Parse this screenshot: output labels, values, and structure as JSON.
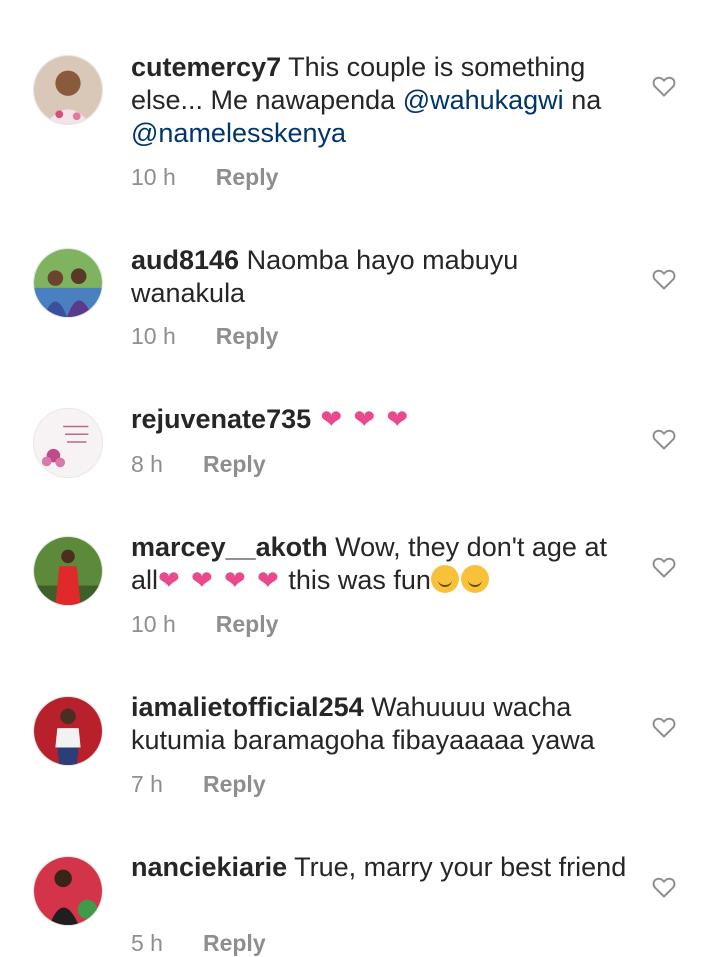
{
  "comments": [
    {
      "username": "cutemercy7",
      "text_part1": " This couple is something else... Me nawapenda ",
      "mention1": "@wahukagwi",
      "text_part2": " na ",
      "mention2": "@namelesskenya",
      "time": "10 h",
      "reply": "Reply"
    },
    {
      "username": "aud8146",
      "text": " Naomba hayo mabuyu wanakula",
      "time": "10 h",
      "reply": "Reply"
    },
    {
      "username": "rejuvenate735",
      "emoji": " ❤ ❤ ❤",
      "time": "8 h",
      "reply": "Reply"
    },
    {
      "username": "marcey__akoth",
      "text_part1": " Wow, they don't age at all",
      "emoji": "❤ ❤ ❤ ❤",
      "text_part2": " this was fun",
      "time": "10 h",
      "reply": "Reply"
    },
    {
      "username": "iamalietofficial254",
      "text": " Wahuuuu wacha kutumia baramagoha fibayaaaaa yawa",
      "time": "7 h",
      "reply": "Reply"
    },
    {
      "username": "nanciekiarie",
      "text": " True, marry your best friend",
      "time": "5 h",
      "reply": "Reply"
    }
  ],
  "colors": {
    "text": "#262626",
    "meta": "#8e8e8e",
    "mention": "#003569",
    "heart_emoji": "#e84a8d"
  },
  "icons": {
    "like": "heart-outline-icon",
    "smile": "smiling-face-emoji"
  }
}
